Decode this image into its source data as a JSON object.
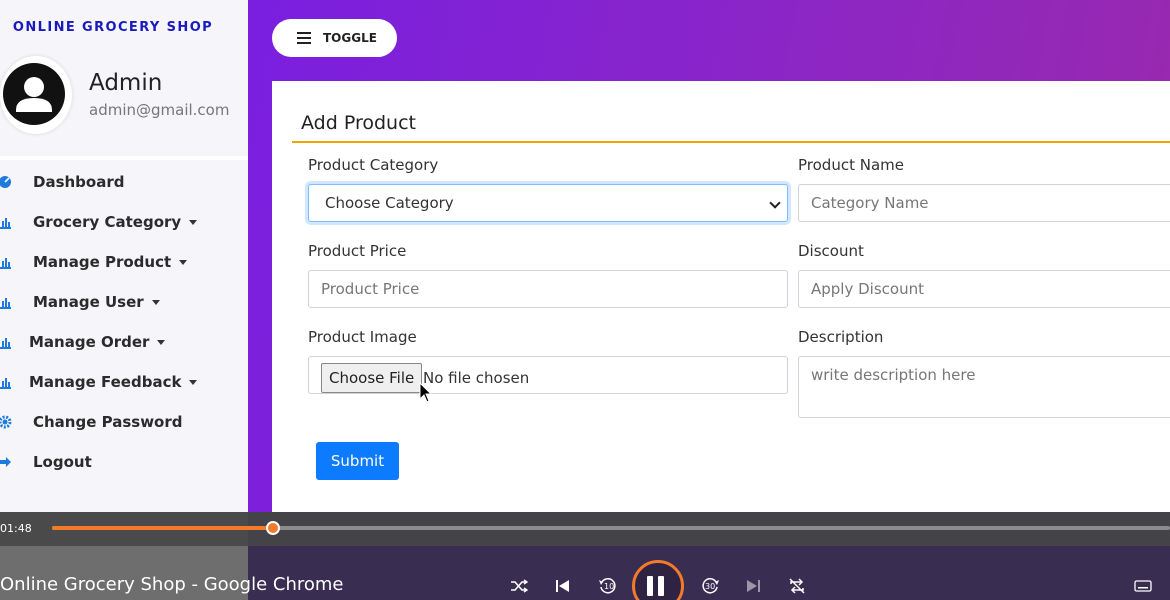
{
  "sidebar": {
    "brand": "ONLINE GROCERY SHOP",
    "user_name": "Admin",
    "user_email": "admin@gmail.com",
    "items": [
      {
        "label": "Dashboard",
        "icon": "dashboard-icon",
        "dropdown": false
      },
      {
        "label": "Grocery Category",
        "icon": "chart-bar-icon",
        "dropdown": true
      },
      {
        "label": "Manage Product",
        "icon": "chart-bar-icon",
        "dropdown": true
      },
      {
        "label": "Manage User",
        "icon": "chart-bar-icon",
        "dropdown": true
      },
      {
        "label": "Manage Order",
        "icon": "chart-bar-icon",
        "dropdown": true
      },
      {
        "label": "Manage Feedback",
        "icon": "chart-bar-icon",
        "dropdown": true
      },
      {
        "label": "Change Password",
        "icon": "gear-icon",
        "dropdown": false
      },
      {
        "label": "Logout",
        "icon": "logout-icon",
        "dropdown": false
      }
    ]
  },
  "toolbar": {
    "toggle_label": "TOGGLE"
  },
  "form": {
    "title": "Add Product",
    "category_label": "Product Category",
    "category_value": "Choose Category",
    "name_label": "Product Name",
    "name_placeholder": "Category Name",
    "price_label": "Product Price",
    "price_placeholder": "Product Price",
    "discount_label": "Discount",
    "discount_placeholder": "Apply Discount",
    "image_label": "Product Image",
    "choose_file_label": "Choose File",
    "no_file_text": "No file chosen",
    "description_label": "Description",
    "description_placeholder": "write description here",
    "submit_label": "Submit"
  },
  "player": {
    "time": "01:48",
    "progress": 0.198,
    "window_title": "Online Grocery Shop - Google Chrome",
    "accent": "#f47a2b",
    "rewind_label": "10",
    "forward_label": "30"
  },
  "colors": {
    "brand": "#1a1abf",
    "accent_rule": "#f0a500",
    "submit": "#0d7bff",
    "nav_icon": "#1f7ae0"
  }
}
